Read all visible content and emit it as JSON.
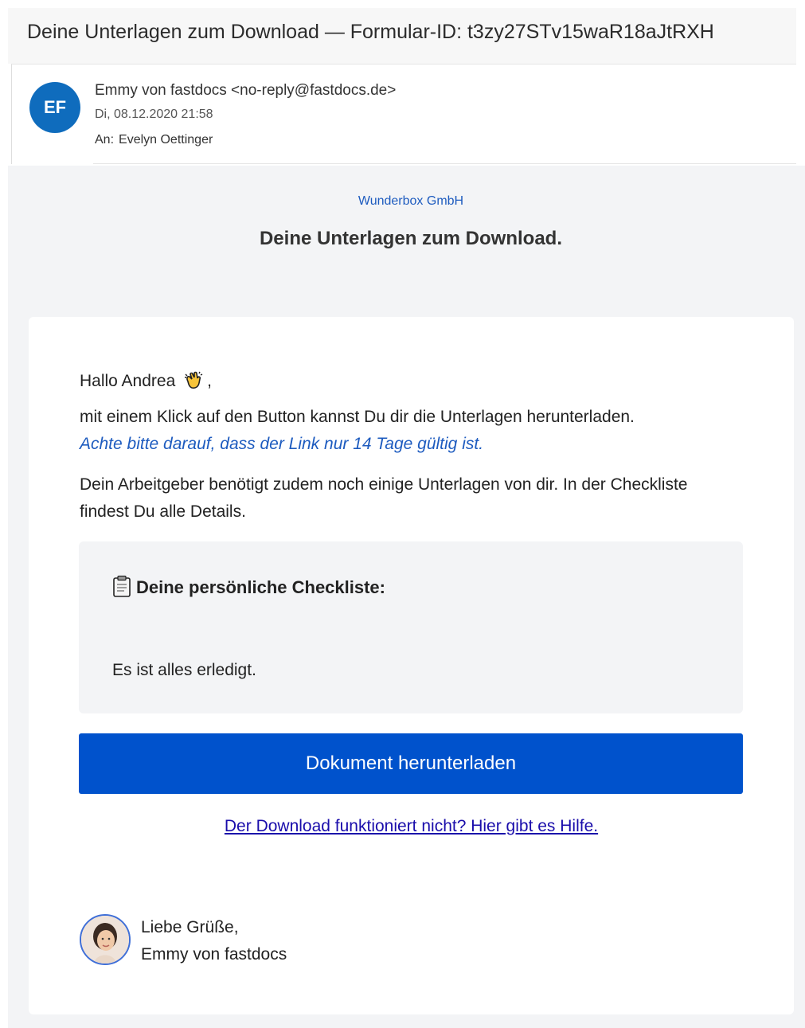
{
  "subject": "Deine Unterlagen zum Download — Formular-ID: t3zy27STv15waR18aJtRXH",
  "header": {
    "initials": "EF",
    "sender": "Emmy von fastdocs <no-reply@fastdocs.de>",
    "date": "Di, 08.12.2020 21:58",
    "to_label": "An:",
    "to_name": "Evelyn Oettinger",
    "avatar_color": "#0f6cbd"
  },
  "email": {
    "company": "Wunderbox GmbH",
    "headline": "Deine Unterlagen zum Download.",
    "greeting_prefix": "Hallo Andrea",
    "greeting_suffix": ",",
    "line1": "mit einem Klick auf den Button kannst Du dir die Unterlagen herunterladen.",
    "note": "Achte bitte darauf, dass der Link nur 14 Tage gültig ist.",
    "para2": "Dein Arbeitgeber benötigt zudem noch einige Unterlagen von dir. In der Checkliste findest Du alle Details.",
    "checklist_title": "Deine persönliche Checkliste:",
    "checklist_status": "Es ist alles erledigt.",
    "button_label": "Dokument herunterladen",
    "help_link": "Der Download funktioniert nicht? Hier gibt es Hilfe.",
    "signoff_line1": "Liebe Grüße,",
    "signoff_line2": "Emmy von fastdocs",
    "accent_color": "#0052cc",
    "link_color": "#1d5bbf"
  },
  "icons": [
    "waving-hand-icon",
    "clipboard-icon"
  ]
}
